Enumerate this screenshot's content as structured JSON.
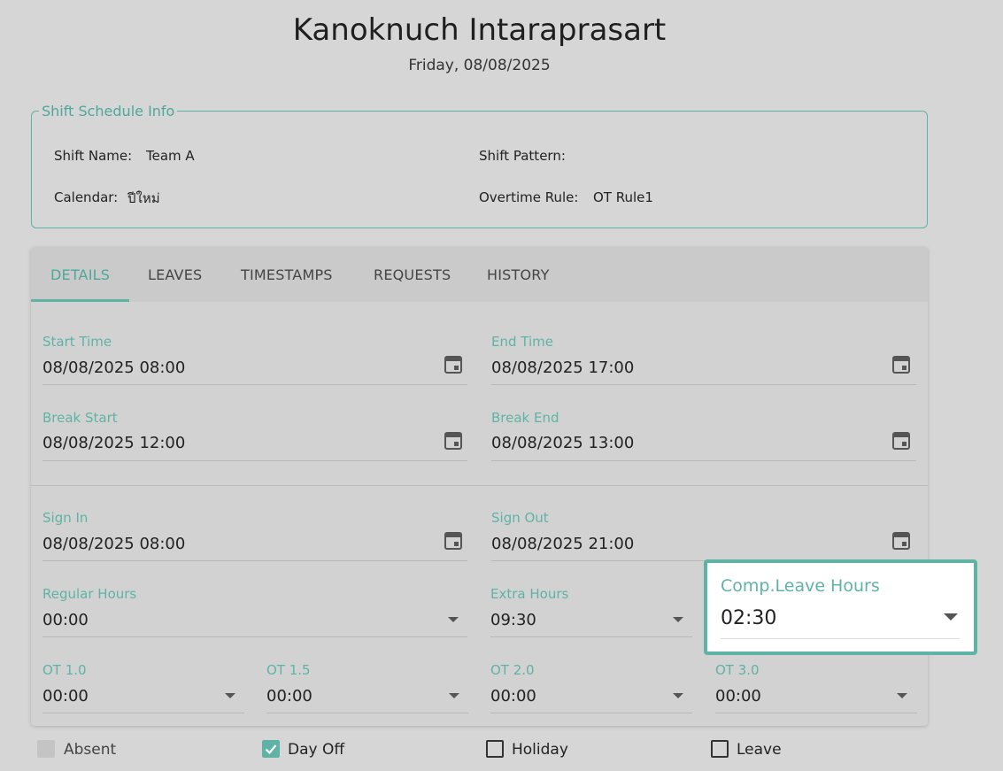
{
  "header": {
    "name": "Kanoknuch Intaraprasart",
    "date": "Friday, 08/08/2025"
  },
  "shift_info": {
    "legend": "Shift Schedule Info",
    "shift_name_label": "Shift Name:",
    "shift_name_value": "Team A",
    "shift_pattern_label": "Shift Pattern:",
    "shift_pattern_value": "",
    "calendar_label": "Calendar:",
    "calendar_value": "ปีใหม่",
    "overtime_rule_label": "Overtime Rule:",
    "overtime_rule_value": "OT Rule1"
  },
  "tabs": [
    "DETAILS",
    "LEAVES",
    "TIMESTAMPS",
    "REQUESTS",
    "HISTORY"
  ],
  "active_tab": "DETAILS",
  "fields": {
    "start_time": {
      "label": "Start Time",
      "value": "08/08/2025 08:00"
    },
    "end_time": {
      "label": "End Time",
      "value": "08/08/2025 17:00"
    },
    "break_start": {
      "label": "Break Start",
      "value": "08/08/2025 12:00"
    },
    "break_end": {
      "label": "Break End",
      "value": "08/08/2025 13:00"
    },
    "sign_in": {
      "label": "Sign In",
      "value": "08/08/2025 08:00"
    },
    "sign_out": {
      "label": "Sign Out",
      "value": "08/08/2025 21:00"
    },
    "regular_hours": {
      "label": "Regular Hours",
      "value": "00:00"
    },
    "extra_hours": {
      "label": "Extra Hours",
      "value": "09:30"
    },
    "comp_leave_hours": {
      "label": "Comp.Leave Hours",
      "value": "02:30"
    },
    "ot_1_0": {
      "label": "OT 1.0",
      "value": "00:00"
    },
    "ot_1_5": {
      "label": "OT 1.5",
      "value": "00:00"
    },
    "ot_2_0": {
      "label": "OT 2.0",
      "value": "00:00"
    },
    "ot_3_0": {
      "label": "OT 3.0",
      "value": "00:00"
    }
  },
  "checkboxes": {
    "absent": {
      "label": "Absent",
      "checked": false,
      "disabled": true
    },
    "day_off": {
      "label": "Day Off",
      "checked": true
    },
    "holiday": {
      "label": "Holiday",
      "checked": false
    },
    "leave": {
      "label": "Leave",
      "checked": false
    }
  },
  "colors": {
    "accent": "#5fb3a5",
    "background": "#d6d6d6"
  }
}
